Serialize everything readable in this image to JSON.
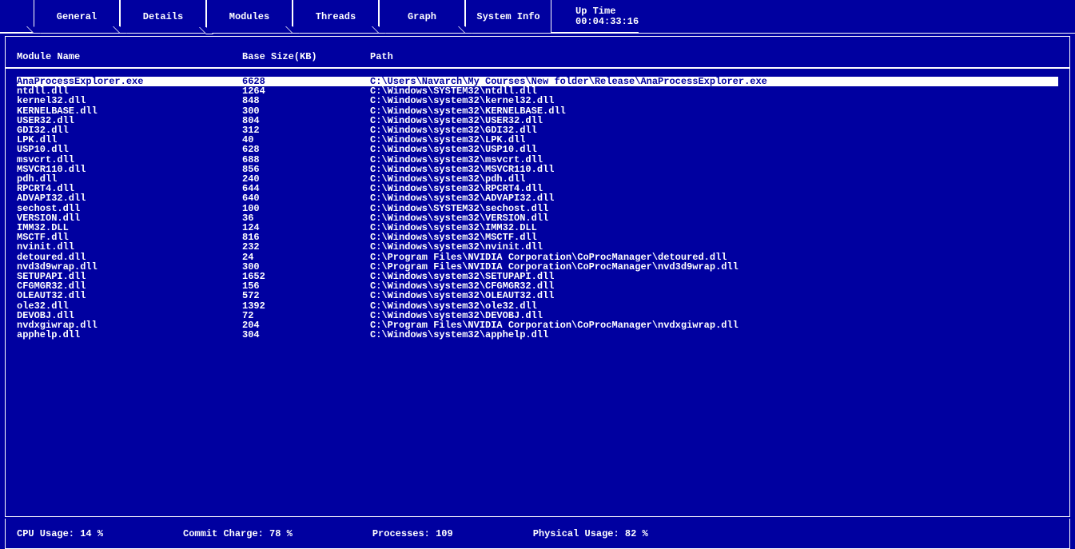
{
  "tabs": {
    "general": "General",
    "details": "Details",
    "modules": "Modules",
    "threads": "Threads",
    "graph": "Graph",
    "system_info": "System Info"
  },
  "uptime": {
    "label": "Up Time",
    "value": "00:04:33:16"
  },
  "columns": {
    "name": "Module Name",
    "size": "Base Size(KB)",
    "path": "Path"
  },
  "selected_index": 0,
  "modules": [
    {
      "name": "AnaProcessExplorer.exe",
      "size": "6628",
      "path": "C:\\Users\\Navarch\\My Courses\\New folder\\Release\\AnaProcessExplorer.exe"
    },
    {
      "name": "ntdll.dll",
      "size": "1264",
      "path": "C:\\Windows\\SYSTEM32\\ntdll.dll"
    },
    {
      "name": "kernel32.dll",
      "size": "848",
      "path": "C:\\Windows\\system32\\kernel32.dll"
    },
    {
      "name": "KERNELBASE.dll",
      "size": "300",
      "path": "C:\\Windows\\system32\\KERNELBASE.dll"
    },
    {
      "name": "USER32.dll",
      "size": "804",
      "path": "C:\\Windows\\system32\\USER32.dll"
    },
    {
      "name": "GDI32.dll",
      "size": "312",
      "path": "C:\\Windows\\system32\\GDI32.dll"
    },
    {
      "name": "LPK.dll",
      "size": "40",
      "path": "C:\\Windows\\system32\\LPK.dll"
    },
    {
      "name": "USP10.dll",
      "size": "628",
      "path": "C:\\Windows\\system32\\USP10.dll"
    },
    {
      "name": "msvcrt.dll",
      "size": "688",
      "path": "C:\\Windows\\system32\\msvcrt.dll"
    },
    {
      "name": "MSVCR110.dll",
      "size": "856",
      "path": "C:\\Windows\\system32\\MSVCR110.dll"
    },
    {
      "name": "pdh.dll",
      "size": "240",
      "path": "C:\\Windows\\system32\\pdh.dll"
    },
    {
      "name": "RPCRT4.dll",
      "size": "644",
      "path": "C:\\Windows\\system32\\RPCRT4.dll"
    },
    {
      "name": "ADVAPI32.dll",
      "size": "640",
      "path": "C:\\Windows\\system32\\ADVAPI32.dll"
    },
    {
      "name": "sechost.dll",
      "size": "100",
      "path": "C:\\Windows\\SYSTEM32\\sechost.dll"
    },
    {
      "name": "VERSION.dll",
      "size": "36",
      "path": "C:\\Windows\\system32\\VERSION.dll"
    },
    {
      "name": "IMM32.DLL",
      "size": "124",
      "path": "C:\\Windows\\system32\\IMM32.DLL"
    },
    {
      "name": "MSCTF.dll",
      "size": "816",
      "path": "C:\\Windows\\system32\\MSCTF.dll"
    },
    {
      "name": "nvinit.dll",
      "size": "232",
      "path": "C:\\Windows\\system32\\nvinit.dll"
    },
    {
      "name": "detoured.dll",
      "size": "24",
      "path": "C:\\Program Files\\NVIDIA Corporation\\CoProcManager\\detoured.dll"
    },
    {
      "name": "nvd3d9wrap.dll",
      "size": "300",
      "path": "C:\\Program Files\\NVIDIA Corporation\\CoProcManager\\nvd3d9wrap.dll"
    },
    {
      "name": "SETUPAPI.dll",
      "size": "1652",
      "path": "C:\\Windows\\system32\\SETUPAPI.dll"
    },
    {
      "name": "CFGMGR32.dll",
      "size": "156",
      "path": "C:\\Windows\\system32\\CFGMGR32.dll"
    },
    {
      "name": "OLEAUT32.dll",
      "size": "572",
      "path": "C:\\Windows\\system32\\OLEAUT32.dll"
    },
    {
      "name": "ole32.dll",
      "size": "1392",
      "path": "C:\\Windows\\system32\\ole32.dll"
    },
    {
      "name": "DEVOBJ.dll",
      "size": "72",
      "path": "C:\\Windows\\system32\\DEVOBJ.dll"
    },
    {
      "name": "nvdxgiwrap.dll",
      "size": "204",
      "path": "C:\\Program Files\\NVIDIA Corporation\\CoProcManager\\nvdxgiwrap.dll"
    },
    {
      "name": "apphelp.dll",
      "size": "304",
      "path": "C:\\Windows\\system32\\apphelp.dll"
    }
  ],
  "status": {
    "cpu": "CPU Usage: 14 %",
    "commit": "Commit Charge: 78 %",
    "processes": "Processes: 109",
    "physical": "Physical Usage: 82 %"
  }
}
